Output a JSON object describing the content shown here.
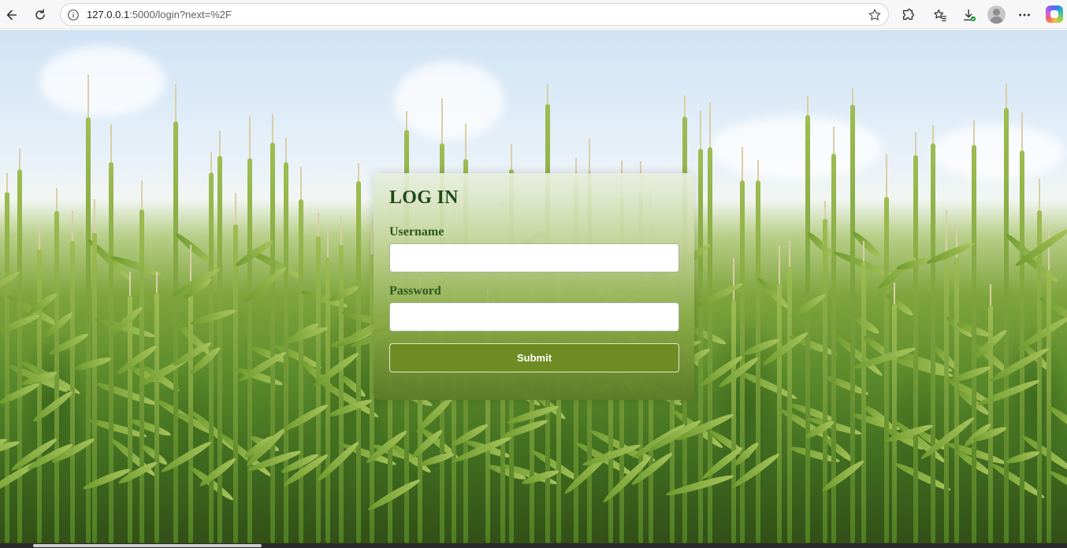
{
  "browser": {
    "url_host": "127.0.0.1",
    "url_rest": ":5000/login?next=%2F",
    "icons": [
      "back-icon",
      "refresh-icon",
      "info-icon",
      "star-icon",
      "extensions-icon",
      "favorites-icon",
      "downloads-icon",
      "profile-avatar",
      "more-icon",
      "copilot-icon"
    ]
  },
  "login": {
    "title": "LOG IN",
    "username_label": "Username",
    "username_value": "",
    "password_label": "Password",
    "password_value": "",
    "submit_label": "Submit"
  },
  "colors": {
    "title_green": "#1f4a1a",
    "button_green": "#6f8c24"
  }
}
